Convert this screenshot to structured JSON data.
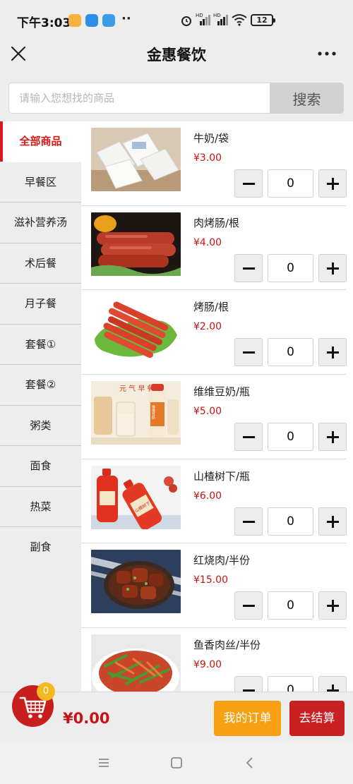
{
  "status_bar": {
    "time": "下午3:03",
    "battery": "12",
    "network_labels": [
      "HD",
      "HD"
    ]
  },
  "title_bar": {
    "title": "金惠餐饮"
  },
  "search": {
    "placeholder": "请输入您想找的商品",
    "value": "",
    "button_label": "搜索"
  },
  "categories": [
    {
      "label": "全部商品",
      "active": true
    },
    {
      "label": "早餐区",
      "active": false
    },
    {
      "label": "滋补营养汤",
      "active": false
    },
    {
      "label": "术后餐",
      "active": false
    },
    {
      "label": "月子餐",
      "active": false
    },
    {
      "label": "套餐①",
      "active": false
    },
    {
      "label": "套餐②",
      "active": false
    },
    {
      "label": "粥类",
      "active": false
    },
    {
      "label": "面食",
      "active": false
    },
    {
      "label": "热菜",
      "active": false
    },
    {
      "label": "副食",
      "active": false
    }
  ],
  "products": [
    {
      "name": "牛奶/袋",
      "price": "¥3.00",
      "quantity": "0"
    },
    {
      "name": "肉烤肠/根",
      "price": "¥4.00",
      "quantity": "0"
    },
    {
      "name": "烤肠/根",
      "price": "¥2.00",
      "quantity": "0"
    },
    {
      "name": "维维豆奶/瓶",
      "price": "¥5.00",
      "quantity": "0"
    },
    {
      "name": "山楂树下/瓶",
      "price": "¥6.00",
      "quantity": "0"
    },
    {
      "name": "红烧肉/半份",
      "price": "¥15.00",
      "quantity": "0"
    },
    {
      "name": "鱼香肉丝/半份",
      "price": "¥9.00",
      "quantity": "0"
    }
  ],
  "cart": {
    "badge_count": "0",
    "total": "¥0.00",
    "orders_label": "我的订单",
    "checkout_label": "去结算"
  },
  "product_image_text": {
    "soy_milk_banner": "元 气 早 餐",
    "soy_milk_bottle": "维维豆奶",
    "hawthorn_bottle": "山楂树下"
  },
  "colors": {
    "accent_red": "#d71a1a",
    "price_red": "#c81414",
    "orders_orange": "#f8a012",
    "badge_yellow": "#f4b91e",
    "background": "#ededed"
  },
  "icons": {
    "close": "close-icon",
    "more": "more-icon",
    "cart": "cart-icon",
    "nav_menu": "menu-icon",
    "nav_home": "home-icon",
    "nav_back": "back-icon"
  }
}
